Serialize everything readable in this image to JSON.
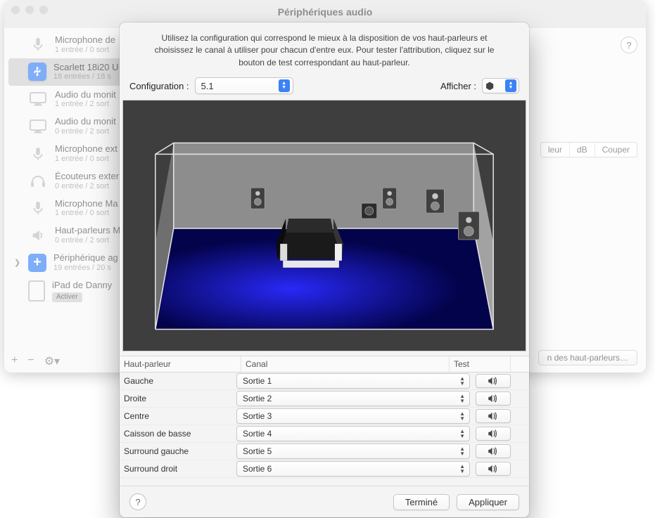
{
  "back": {
    "title": "Périphériques audio",
    "segments": [
      "leur",
      "dB",
      "Couper"
    ],
    "bottom_button": "n des haut-parleurs…"
  },
  "sidebar": {
    "items": [
      {
        "name": "Microphone de",
        "sub": "1 entrée / 0 sort"
      },
      {
        "name": "Scarlett 18i20 U",
        "sub": "18 entrées / 18 s",
        "selected": true,
        "kind": "usb"
      },
      {
        "name": "Audio du monit",
        "sub": "1 entrée / 2 sort",
        "kind": "mon"
      },
      {
        "name": "Audio du monit",
        "sub": "0 entrée / 2 sort",
        "kind": "mon"
      },
      {
        "name": "Microphone ext",
        "sub": "1 entrée / 0 sort",
        "kind": "mic"
      },
      {
        "name": "Écouteurs exter",
        "sub": "0 entrée / 2 sort",
        "kind": "head"
      },
      {
        "name": "Microphone Ma",
        "sub": "1 entrée / 0 sort",
        "kind": "mic"
      },
      {
        "name": "Haut-parleurs M",
        "sub": "0 entrée / 2 sort",
        "kind": "spk"
      },
      {
        "name": "Périphérique ag",
        "sub": "19 entrées / 20 s",
        "kind": "agr",
        "chev": true
      },
      {
        "name": "iPad de Danny",
        "badge": "Activer",
        "kind": "ipad"
      }
    ],
    "footer": {
      "add": "+",
      "remove": "−",
      "gear": "⚙︎▾"
    }
  },
  "sheet": {
    "intro": "Utilisez la configuration qui correspond le mieux à la disposition de vos haut-parleurs et choisissez le canal à utiliser pour chacun d'entre eux. Pour tester l'attribution, cliquez sur le bouton de test correspondant au haut-parleur.",
    "config_label": "Configuration :",
    "config_value": "5.1",
    "show_label": "Afficher :",
    "columns": {
      "speaker": "Haut-parleur",
      "channel": "Canal",
      "test": "Test"
    },
    "rows": [
      {
        "speaker": "Gauche",
        "channel": "Sortie 1"
      },
      {
        "speaker": "Droite",
        "channel": "Sortie 2"
      },
      {
        "speaker": "Centre",
        "channel": "Sortie 3"
      },
      {
        "speaker": "Caisson de basse",
        "channel": "Sortie 4"
      },
      {
        "speaker": "Surround gauche",
        "channel": "Sortie 5"
      },
      {
        "speaker": "Surround droit",
        "channel": "Sortie 6"
      }
    ],
    "buttons": {
      "done": "Terminé",
      "apply": "Appliquer",
      "help": "?"
    }
  }
}
